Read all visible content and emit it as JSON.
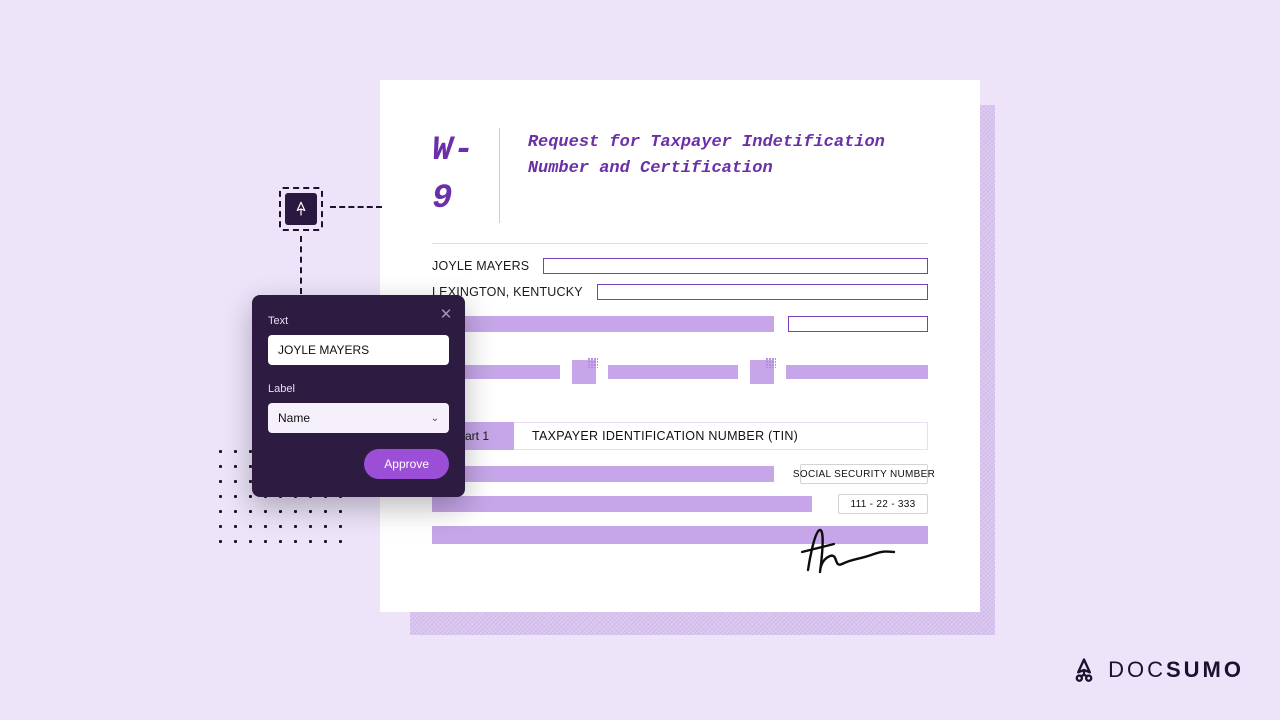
{
  "form": {
    "code": "W-9",
    "title": "Request for Taxpayer Indetification Number and Certification",
    "name": "JOYLE MAYERS",
    "location": "LEXINGTON, KENTUCKY",
    "tin_tab": "Part 1",
    "tin_title": "TAXPAYER IDENTIFICATION NUMBER (TIN)",
    "ssn_label": "SOCIAL SECURITY NUMBER",
    "ssn_value": "111 - 22 - 333"
  },
  "popover": {
    "text_label": "Text",
    "text_value": "JOYLE MAYERS",
    "label_label": "Label",
    "label_value": "Name",
    "approve": "Approve"
  },
  "brand": {
    "name_thin": "DOC",
    "name_bold": "SUMO"
  }
}
